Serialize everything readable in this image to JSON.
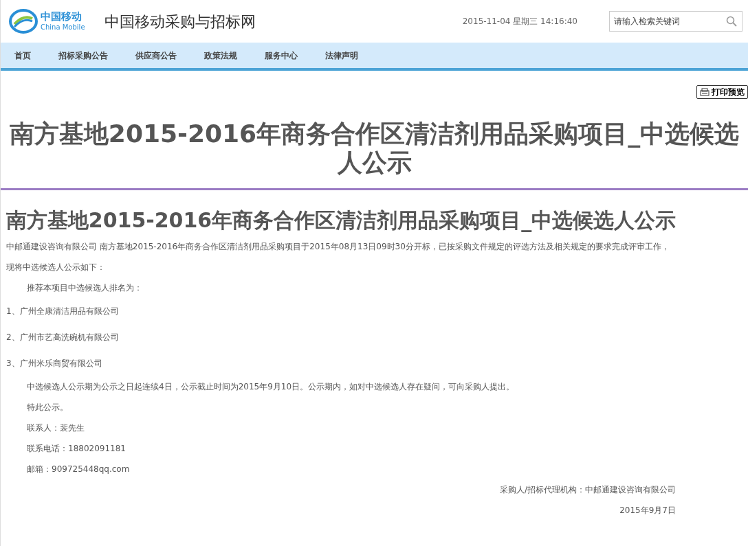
{
  "header": {
    "logo": {
      "name": "中国移动",
      "subtitle": "China Mobile"
    },
    "site_title": "中国移动采购与招标网",
    "datetime": "2015-11-04 星期三 14:16:40",
    "search": {
      "placeholder": "请输入检索关键词"
    }
  },
  "nav": {
    "items": [
      "首页",
      "招标采购公告",
      "供应商公告",
      "政策法规",
      "服务中心",
      "法律声明"
    ]
  },
  "print_button": "打印预览",
  "page_title": "南方基地2015-2016年商务合作区清洁剂用品采购项目_中选候选人公示",
  "article": {
    "title": "南方基地2015-2016年商务合作区清洁剂用品采购项目_中选候选人公示",
    "paragraphs": [
      {
        "kind": "plain",
        "text": "中邮通建设咨询有限公司 南方基地2015-2016年商务合作区清洁剂用品采购项目于2015年08月13日09时30分开标，已按采购文件规定的评选方法及相关规定的要求完成评审工作，现将中选候选人公示如下："
      },
      {
        "kind": "indented",
        "text": "推荐本项目中选候选人排名为："
      },
      {
        "kind": "list",
        "text": "1、广州全康清洁用品有限公司"
      },
      {
        "kind": "list",
        "text": "2、广州市艺高洗碗机有限公司"
      },
      {
        "kind": "list",
        "text": "3、广州米乐商贸有限公司"
      },
      {
        "kind": "indented",
        "text": "中选候选人公示期为公示之日起连续4日，公示截止时间为2015年9月10日。公示期内，如对中选候选人存在疑问，可向采购人提出。"
      },
      {
        "kind": "indented",
        "text": "特此公示。"
      },
      {
        "kind": "indented",
        "text": "联系人：裴先生"
      },
      {
        "kind": "indented",
        "text": "联系电话：18802091181"
      },
      {
        "kind": "indented",
        "text": "邮箱：909725448qq.com"
      },
      {
        "kind": "right",
        "text": "采购人/招标代理机构：中邮通建设咨询有限公司"
      },
      {
        "kind": "right",
        "text": "2015年9月7日"
      }
    ]
  }
}
